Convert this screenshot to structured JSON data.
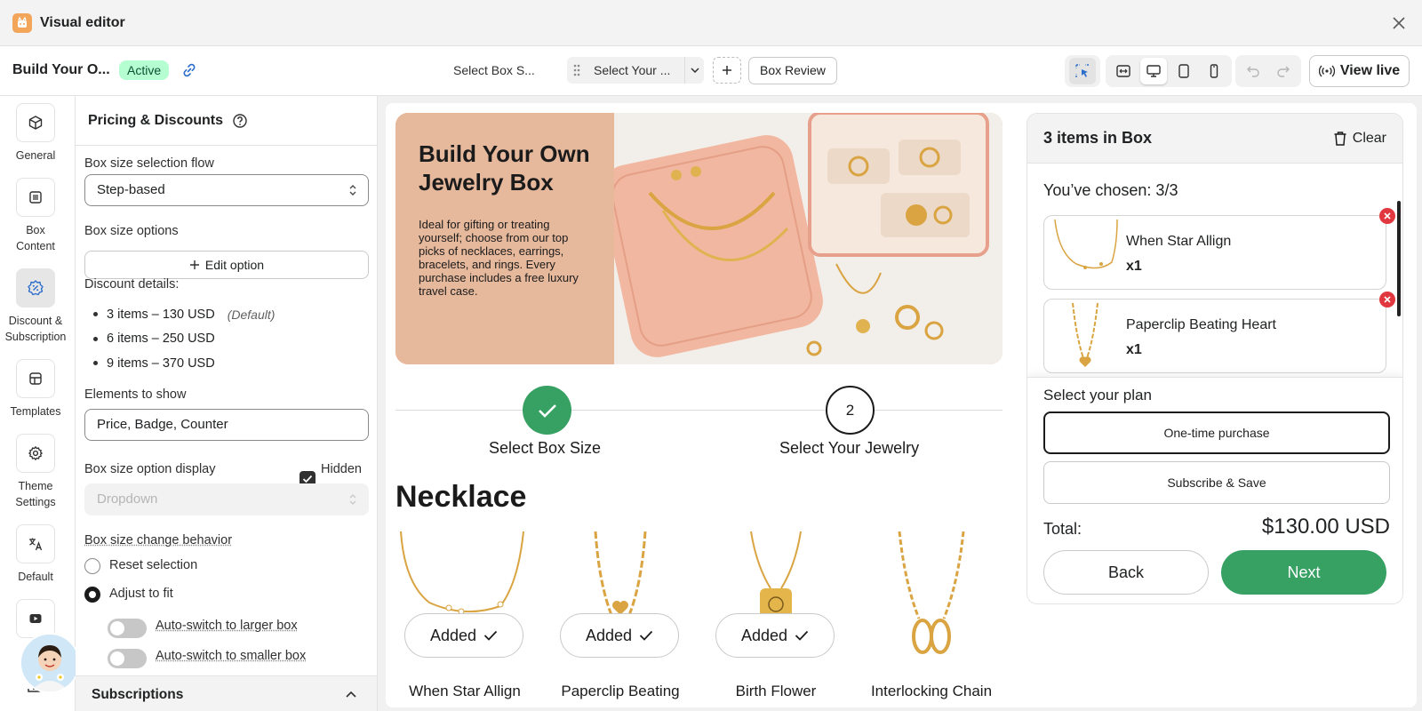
{
  "window": {
    "title": "Visual editor"
  },
  "toolbar": {
    "box_name": "Build Your O...",
    "status": "Active",
    "steps": [
      "Select Box S...",
      "Select Your ...",
      "Box Review"
    ],
    "view_live": "View live"
  },
  "rail": {
    "items": [
      {
        "label": "General",
        "icon": "cube-icon"
      },
      {
        "label": "Box Content",
        "icon": "list-icon"
      },
      {
        "label": "Discount & Subscription",
        "icon": "discount-icon"
      },
      {
        "label": "Templates",
        "icon": "layout-icon"
      },
      {
        "label": "Theme Settings",
        "icon": "gear-icon"
      },
      {
        "label": "Default",
        "icon": "translate-icon"
      },
      {
        "label": "T",
        "icon": "video-icon"
      }
    ]
  },
  "panel": {
    "title": "Pricing & Discounts",
    "flow_label": "Box size selection flow",
    "flow_value": "Step-based",
    "options_label": "Box size options",
    "edit_option": "Edit option",
    "discount_label": "Discount details:",
    "discounts": [
      {
        "text": "3 items – 130 USD",
        "note": "(Default)"
      },
      {
        "text": "6 items – 250 USD",
        "note": ""
      },
      {
        "text": "9 items – 370 USD",
        "note": ""
      }
    ],
    "elements_label": "Elements to show",
    "elements_value": "Price, Badge, Counter",
    "display_label": "Box size option display",
    "hidden_label": "Hidden",
    "display_value": "Dropdown",
    "change_label": "Box size change behavior",
    "reset_label": "Reset selection",
    "adjust_label": "Adjust to fit",
    "auto_larger": "Auto-switch to larger box",
    "auto_smaller": "Auto-switch to smaller box",
    "subscriptions": "Subscriptions"
  },
  "preview": {
    "banner_title": "Build Your Own Jewelry Box",
    "banner_desc": "Ideal for gifting or treating yourself; choose from our top picks of necklaces, earrings, bracelets, and rings. Every purchase includes a free luxury travel case.",
    "step1": "Select Box Size",
    "step2_num": "2",
    "step2": "Select Your Jewelry",
    "section": "Necklace",
    "added": "Added",
    "products": [
      "When Star Allign",
      "Paperclip Beating",
      "Birth Flower",
      "Interlocking Chain"
    ]
  },
  "cart": {
    "count": "3 items in Box",
    "clear": "Clear",
    "chosen": "You’ve chosen:  3/3",
    "items": [
      {
        "name": "When Star Allign",
        "qty": "x1"
      },
      {
        "name": "Paperclip Beating Heart",
        "qty": "x1"
      }
    ],
    "plan_title": "Select your plan",
    "plan_one": "One-time purchase",
    "plan_sub": "Subscribe & Save",
    "total_label": "Total:",
    "total_value": "$130.00 USD",
    "back": "Back",
    "next": "Next"
  },
  "colors": {
    "accent_green": "#37a063",
    "active_badge": "#b4fed2",
    "banner_bg": "#e6b89c",
    "remove_red": "#e0383e"
  }
}
